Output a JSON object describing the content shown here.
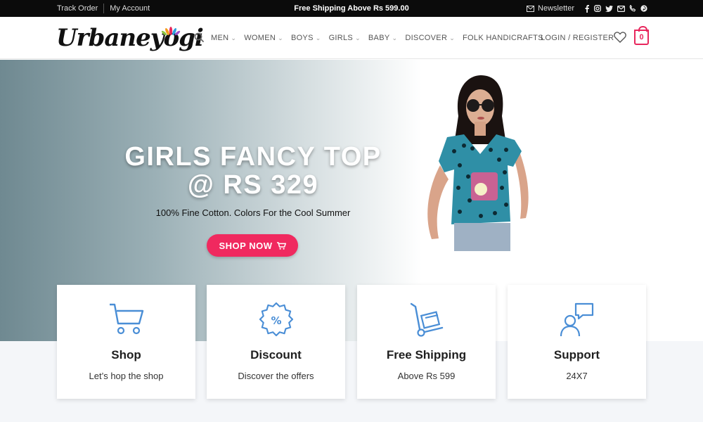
{
  "topbar": {
    "track_order": "Track Order",
    "my_account": "My Account",
    "promo": "Free Shipping Above Rs 599.00",
    "newsletter": "Newsletter",
    "social_icons": [
      "facebook-icon",
      "instagram-icon",
      "twitter-icon",
      "email-icon",
      "phone-icon",
      "pinterest-icon"
    ]
  },
  "header": {
    "logo_text": "Urbaneyogi",
    "nav": [
      {
        "label": "MEN",
        "dropdown": true
      },
      {
        "label": "WOMEN",
        "dropdown": true
      },
      {
        "label": "BOYS",
        "dropdown": true
      },
      {
        "label": "GIRLS",
        "dropdown": true
      },
      {
        "label": "BABY",
        "dropdown": true
      },
      {
        "label": "DISCOVER",
        "dropdown": true
      },
      {
        "label": "FOLK HANDICRAFTS",
        "dropdown": false
      }
    ],
    "login": "LOGIN / REGISTER",
    "cart_count": "0"
  },
  "hero": {
    "title_line1": "GIRLS FANCY TOP",
    "title_line2": "@ RS 329",
    "subtitle": "100% Fine Cotton. Colors For the Cool Summer",
    "cta": "SHOP NOW"
  },
  "features": [
    {
      "icon": "shopping-cart-icon",
      "title": "Shop",
      "desc": "Let’s hop the shop"
    },
    {
      "icon": "discount-badge-icon",
      "title": "Discount",
      "desc": "Discover the offers"
    },
    {
      "icon": "hand-truck-icon",
      "title": "Free Shipping",
      "desc": "Above Rs 599"
    },
    {
      "icon": "support-chat-icon",
      "title": "Support",
      "desc": "24X7"
    }
  ],
  "colors": {
    "accent": "#f0295f",
    "topbar": "#0b0b0b",
    "icon_blue": "#4a8ed6"
  }
}
